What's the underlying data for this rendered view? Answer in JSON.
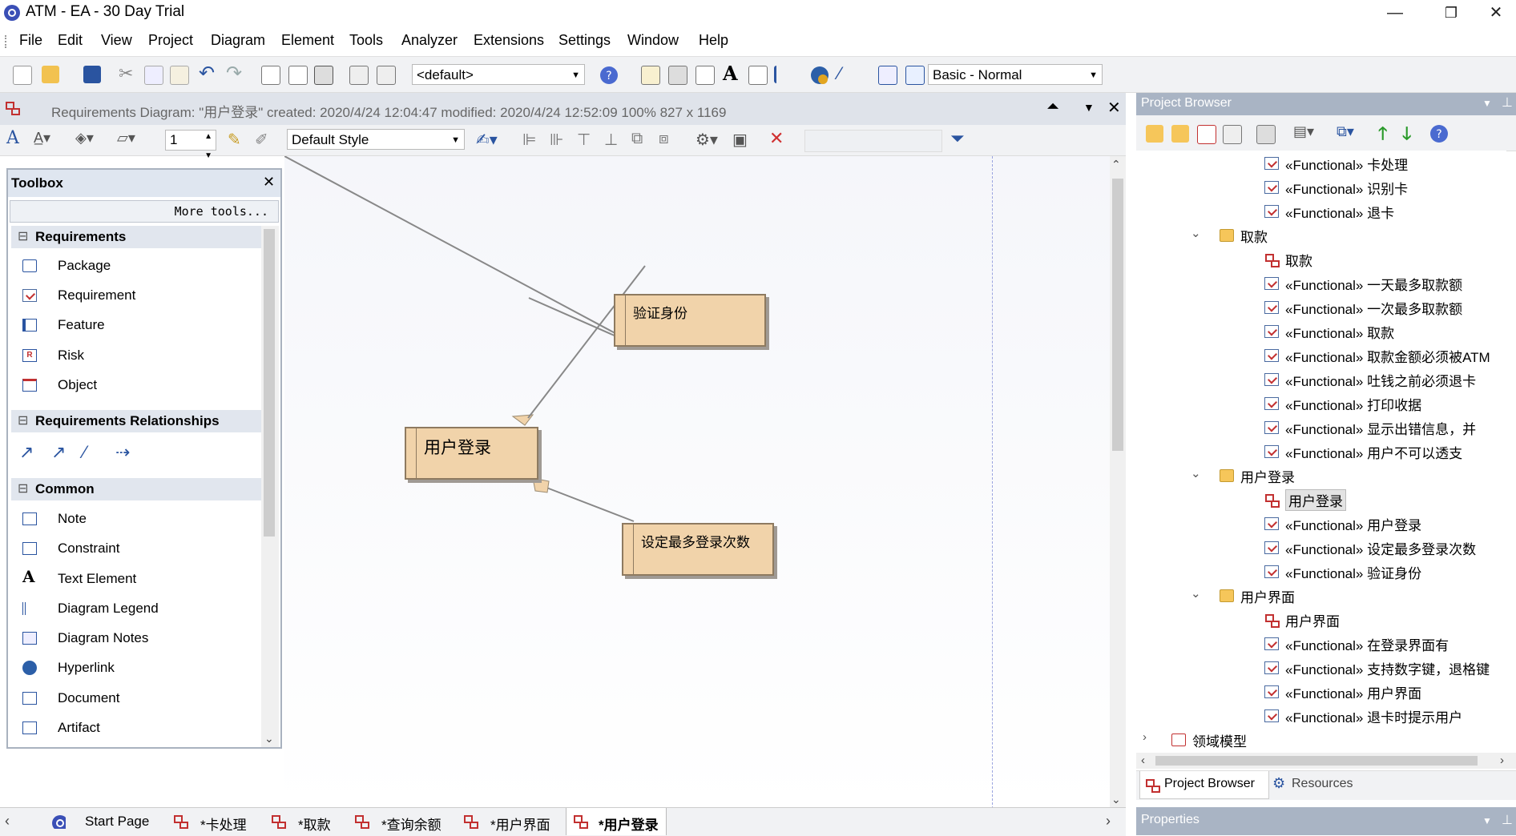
{
  "window": {
    "title": "ATM - EA - 30 Day Trial",
    "minimize": "—",
    "restore": "❐",
    "close": "✕"
  },
  "menu": [
    "File",
    "Edit",
    "View",
    "Project",
    "Diagram",
    "Element",
    "Tools",
    "Analyzer",
    "Extensions",
    "Settings",
    "Window",
    "Help"
  ],
  "toolbar": {
    "default_combo": "<default>",
    "workspace_combo": "Basic - Normal"
  },
  "diagram_header": {
    "info": "Requirements Diagram: \"用户登录\"  created: 2020/4/24 12:04:47  modified: 2020/4/24 12:52:09   100%   827 x 1169"
  },
  "format_toolbar": {
    "line_width": "1",
    "style_combo": "Default Style"
  },
  "toolbox": {
    "title": "Toolbox",
    "more_tools": "More tools...",
    "sections": [
      {
        "title": "Requirements",
        "items": [
          "Package",
          "Requirement",
          "Feature",
          "Risk",
          "Object"
        ]
      },
      {
        "title": "Requirements Relationships",
        "items": []
      },
      {
        "title": "Common",
        "items": [
          "Note",
          "Constraint",
          "Text Element",
          "Diagram Legend",
          "Diagram Notes",
          "Hyperlink",
          "Document",
          "Artifact"
        ]
      }
    ]
  },
  "diagram": {
    "elements": [
      "用户登录",
      "验证身份",
      "设定最多登录次数"
    ]
  },
  "project_browser": {
    "title": "Project Browser",
    "rows": [
      {
        "type": "req",
        "label": "«Functional» 卡处理",
        "level": 2
      },
      {
        "type": "req",
        "label": "«Functional» 识别卡",
        "level": 2
      },
      {
        "type": "req",
        "label": "«Functional» 退卡",
        "level": 2
      },
      {
        "type": "folder",
        "label": "取款",
        "level": 1,
        "expanded": true
      },
      {
        "type": "diagram",
        "label": "取款",
        "level": 2
      },
      {
        "type": "req",
        "label": "«Functional» 一天最多取款额",
        "level": 2
      },
      {
        "type": "req",
        "label": "«Functional» 一次最多取款额",
        "level": 2
      },
      {
        "type": "req",
        "label": "«Functional» 取款",
        "level": 2
      },
      {
        "type": "req",
        "label": "«Functional» 取款金额必须被ATM",
        "level": 2
      },
      {
        "type": "req",
        "label": "«Functional» 吐钱之前必须退卡",
        "level": 2
      },
      {
        "type": "req",
        "label": "«Functional» 打印收据",
        "level": 2
      },
      {
        "type": "req",
        "label": "«Functional» 显示出错信息，并",
        "level": 2
      },
      {
        "type": "req",
        "label": "«Functional» 用户不可以透支",
        "level": 2
      },
      {
        "type": "folder",
        "label": "用户登录",
        "level": 1,
        "expanded": true
      },
      {
        "type": "diagram",
        "label": "用户登录",
        "level": 2,
        "selected": true
      },
      {
        "type": "req",
        "label": "«Functional» 用户登录",
        "level": 2
      },
      {
        "type": "req",
        "label": "«Functional» 设定最多登录次数",
        "level": 2
      },
      {
        "type": "req",
        "label": "«Functional» 验证身份",
        "level": 2
      },
      {
        "type": "folder",
        "label": "用户界面",
        "level": 1,
        "expanded": true
      },
      {
        "type": "diagram",
        "label": "用户界面",
        "level": 2
      },
      {
        "type": "req",
        "label": "«Functional» 在登录界面有",
        "level": 2
      },
      {
        "type": "req",
        "label": "«Functional» 支持数字键，退格键",
        "level": 2
      },
      {
        "type": "req",
        "label": "«Functional» 用户界面",
        "level": 2
      },
      {
        "type": "req",
        "label": "«Functional» 退卡时提示用户",
        "level": 2
      },
      {
        "type": "package",
        "label": "领域模型",
        "level": 0,
        "expanded": false
      }
    ],
    "tabs": [
      "Project Browser",
      "Resources"
    ]
  },
  "properties": {
    "title": "Properties"
  },
  "bottom_tabs": [
    "Start Page",
    "*卡处理",
    "*取款",
    "*查询余额",
    "*用户界面",
    "*用户登录"
  ],
  "chevrons": {
    "expanded": "⌄",
    "collapsed": "›"
  }
}
